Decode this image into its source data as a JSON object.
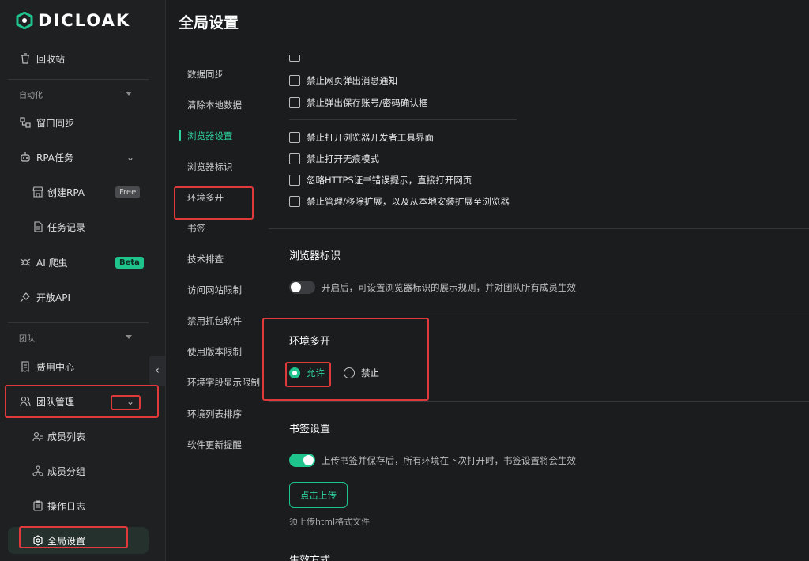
{
  "app": {
    "brand": "DICLOAK",
    "accent": "#1fc48d",
    "annotation_color": "#e0393a"
  },
  "header": {
    "title": "全局设置"
  },
  "sidebar": {
    "recycle": "回收站",
    "automation_section": "自动化",
    "window_sync": "窗口同步",
    "rpa_tasks": "RPA任务",
    "create_rpa": "创建RPA",
    "free_badge": "Free",
    "task_records": "任务记录",
    "ai_crawler": "AI 爬虫",
    "beta_badge": "Beta",
    "open_api": "开放API",
    "team_section": "团队",
    "billing": "费用中心",
    "team_management": "团队管理",
    "member_list": "成员列表",
    "member_groups": "成员分组",
    "operation_log": "操作日志",
    "global_settings": "全局设置"
  },
  "subnav": {
    "items": [
      "数据同步",
      "清除本地数据",
      "浏览器设置",
      "浏览器标识",
      "环境多开",
      "书签",
      "技术排查",
      "访问网站限制",
      "禁用抓包软件",
      "使用版本限制",
      "环境字段显示限制",
      "环境列表排序",
      "软件更新提醒"
    ],
    "active_index": 2
  },
  "browser_settings": {
    "checkboxes_a": [
      "禁止网页弹出消息通知",
      "禁止弹出保存账号/密码确认框"
    ],
    "checkboxes_b": [
      "禁止打开浏览器开发者工具界面",
      "禁止打开无痕模式",
      "忽略HTTPS证书错误提示，直接打开网页",
      "禁止管理/移除扩展，以及从本地安装扩展至浏览器"
    ]
  },
  "browser_identity": {
    "title": "浏览器标识",
    "toggle_on": false,
    "toggle_text": "开启后，可设置浏览器标识的展示规则，并对团队所有成员生效"
  },
  "multi_env": {
    "title": "环境多开",
    "options": [
      "允许",
      "禁止"
    ],
    "selected_index": 0
  },
  "bookmarks": {
    "title": "书签设置",
    "toggle_on": true,
    "toggle_text": "上传书签并保存后，所有环境在下次打开时，书签设置将会生效",
    "upload_button": "点击上传",
    "hint": "须上传html格式文件"
  },
  "effect_mode": {
    "title": "生效方式"
  }
}
